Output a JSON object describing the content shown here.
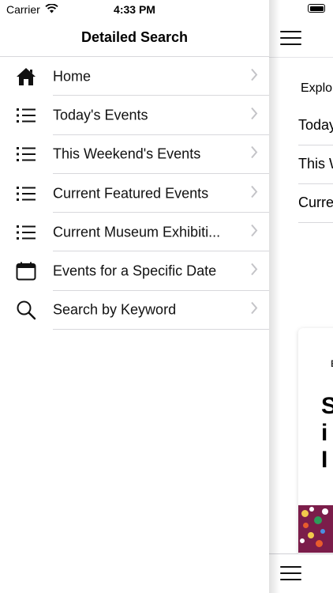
{
  "status_bar": {
    "carrier": "Carrier",
    "time": "4:33 PM"
  },
  "menu": {
    "title": "Detailed Search",
    "items": [
      {
        "label": "Home",
        "icon": "home-icon"
      },
      {
        "label": "Today's Events",
        "icon": "list-icon"
      },
      {
        "label": "This Weekend's Events",
        "icon": "list-icon"
      },
      {
        "label": "Current Featured Events",
        "icon": "list-icon"
      },
      {
        "label": "Current Museum Exhibiti...",
        "icon": "list-icon"
      },
      {
        "label": "Events for a Specific Date",
        "icon": "calendar-icon"
      },
      {
        "label": "Search by Keyword",
        "icon": "search-icon"
      }
    ]
  },
  "background": {
    "explore": "Explo",
    "rows": [
      "Today",
      "This W",
      "Curre"
    ],
    "card": {
      "tag": "E",
      "title_lines": [
        "S",
        "i",
        "I"
      ]
    }
  }
}
